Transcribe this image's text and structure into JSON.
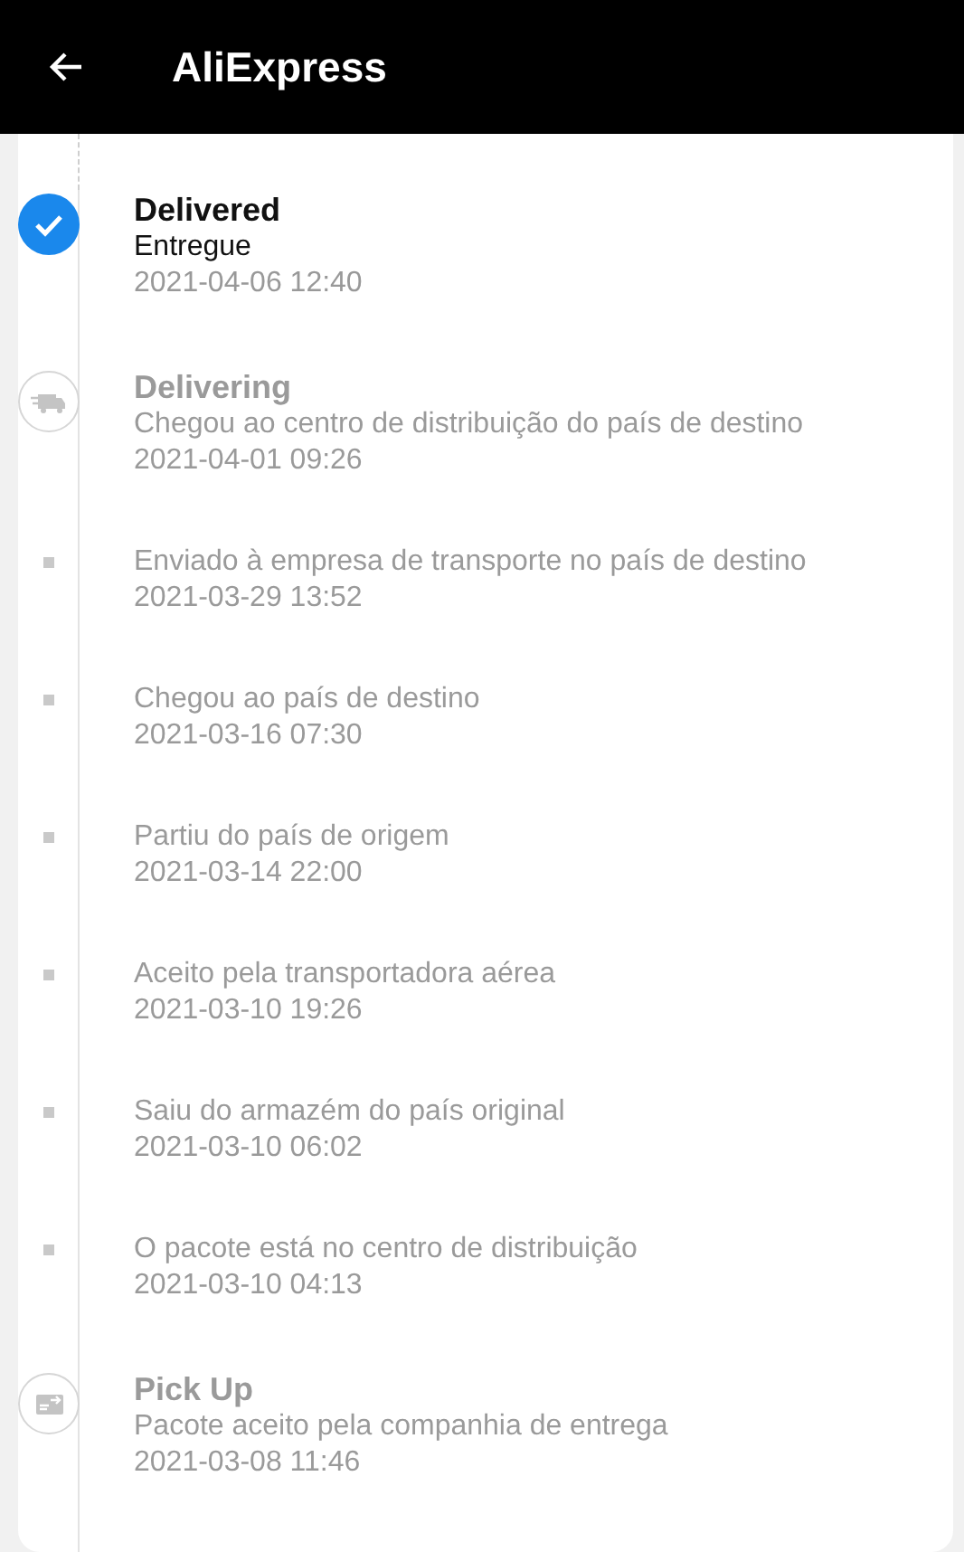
{
  "app_bar": {
    "title": "AliExpress"
  },
  "events": [
    {
      "kind": "delivered",
      "title": "Delivered",
      "text": "Entregue",
      "time": "2021-04-06 12:40"
    },
    {
      "kind": "transit",
      "title": "Delivering",
      "text": "Chegou ao centro de distribuição do país de destino",
      "time": "2021-04-01 09:26"
    },
    {
      "kind": "step",
      "text": "Enviado à empresa de transporte no país de destino",
      "time": "2021-03-29 13:52"
    },
    {
      "kind": "step",
      "text": "Chegou ao país de destino",
      "time": "2021-03-16 07:30"
    },
    {
      "kind": "step",
      "text": "Partiu do país de origem",
      "time": "2021-03-14 22:00"
    },
    {
      "kind": "step",
      "text": "Aceito pela transportadora aérea",
      "time": "2021-03-10 19:26"
    },
    {
      "kind": "step",
      "text": "Saiu do armazém do país original",
      "time": "2021-03-10 06:02"
    },
    {
      "kind": "step",
      "text": "O pacote está no centro de distribuição",
      "time": "2021-03-10 04:13"
    },
    {
      "kind": "pickup",
      "title": "Pick Up",
      "text": "Pacote aceito pela companhia de entrega",
      "time": "2021-03-08 11:46"
    }
  ]
}
